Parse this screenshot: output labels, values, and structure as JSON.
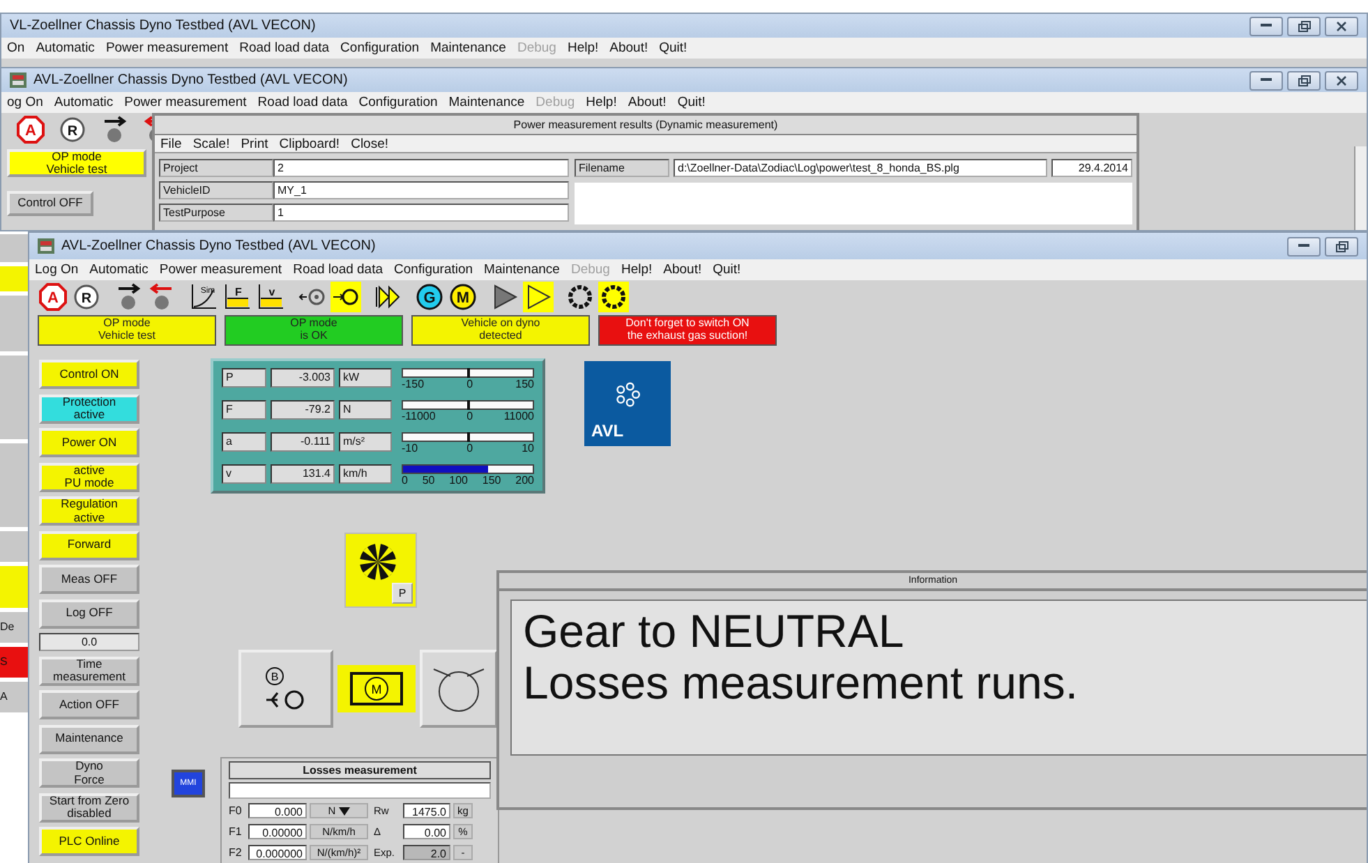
{
  "back_window": {
    "title": "VL-Zoellner Chassis Dyno Testbed  (AVL VECON)",
    "menu": [
      {
        "label": "On",
        "disabled": false
      },
      {
        "label": "Automatic",
        "disabled": false
      },
      {
        "label": "Power measurement",
        "disabled": false
      },
      {
        "label": "Road load data",
        "disabled": false
      },
      {
        "label": "Configuration",
        "disabled": false
      },
      {
        "label": "Maintenance",
        "disabled": false
      },
      {
        "label": "Debug",
        "disabled": true
      },
      {
        "label": "Help!",
        "disabled": false
      },
      {
        "label": "About!",
        "disabled": false
      },
      {
        "label": "Quit!",
        "disabled": false
      }
    ]
  },
  "middle_window": {
    "title": "AVL-Zoellner Chassis Dyno Testbed  (AVL VECON)",
    "menu": [
      {
        "label": "og On",
        "disabled": false
      },
      {
        "label": "Automatic",
        "disabled": false
      },
      {
        "label": "Power measurement",
        "disabled": false
      },
      {
        "label": "Road load data",
        "disabled": false
      },
      {
        "label": "Configuration",
        "disabled": false
      },
      {
        "label": "Maintenance",
        "disabled": false
      },
      {
        "label": "Debug",
        "disabled": true
      },
      {
        "label": "Help!",
        "disabled": false
      },
      {
        "label": "About!",
        "disabled": false
      },
      {
        "label": "Quit!",
        "disabled": false
      }
    ],
    "toolbar": [
      {
        "kind": "stop",
        "label": "A",
        "selected": false
      },
      {
        "kind": "circle",
        "label": "R",
        "selected": false
      },
      {
        "kind": "ball-right",
        "selected": false
      },
      {
        "kind": "ball-left",
        "selected": false
      }
    ],
    "side_buttons": [
      {
        "label": "OP mode\nVehicle test",
        "color": "#ffff00"
      },
      {
        "label": "Control OFF",
        "color": "#c8c8c8"
      }
    ],
    "covered_side_labels": [
      "De",
      "S",
      "A"
    ],
    "results_dialog": {
      "title": "Power measurement results (Dynamic measurement)",
      "menu": [
        "File",
        "Scale!",
        "Print",
        "Clipboard!",
        "Close!"
      ],
      "fields": [
        {
          "label": "Project",
          "value": "2"
        },
        {
          "label": "VehicleID",
          "value": "MY_1"
        },
        {
          "label": "TestPurpose",
          "value": "1"
        }
      ],
      "filename": {
        "label": "Filename",
        "value": "d:\\Zoellner-Data\\Zodiac\\Log\\power\\test_8_honda_BS.plg",
        "date": "29.4.2014"
      }
    }
  },
  "main_window": {
    "title": "AVL-Zoellner Chassis Dyno Testbed  (AVL VECON)",
    "menu": [
      {
        "label": "Log On",
        "disabled": false
      },
      {
        "label": "Automatic",
        "disabled": false
      },
      {
        "label": "Power measurement",
        "disabled": false
      },
      {
        "label": "Road load data",
        "disabled": false
      },
      {
        "label": "Configuration",
        "disabled": false
      },
      {
        "label": "Maintenance",
        "disabled": false
      },
      {
        "label": "Debug",
        "disabled": true
      },
      {
        "label": "Help!",
        "disabled": false
      },
      {
        "label": "About!",
        "disabled": false
      },
      {
        "label": "Quit!",
        "disabled": false
      }
    ],
    "toolbar": [
      {
        "items": [
          {
            "kind": "stop",
            "label": "A",
            "selected": false
          },
          {
            "kind": "circle",
            "label": "R",
            "selected": false
          }
        ]
      },
      {
        "items": [
          {
            "kind": "ball-right",
            "selected": false
          },
          {
            "kind": "ball-left",
            "selected": false
          }
        ]
      },
      {
        "items": [
          {
            "kind": "curve",
            "label": "Sim",
            "selected": false
          },
          {
            "kind": "graph",
            "label": "F",
            "selected": false
          },
          {
            "kind": "graph",
            "label": "v",
            "selected": false
          }
        ]
      },
      {
        "items": [
          {
            "kind": "wheel-in",
            "selected": false
          },
          {
            "kind": "wheel-out",
            "selected": true
          }
        ]
      },
      {
        "items": [
          {
            "kind": "double-play",
            "selected": false
          }
        ]
      },
      {
        "items": [
          {
            "kind": "badge",
            "label": "G",
            "color": "#22ccee",
            "selected": false
          },
          {
            "kind": "badge",
            "label": "M",
            "color": "#ffee00",
            "selected": false
          }
        ]
      },
      {
        "items": [
          {
            "kind": "play",
            "selected": false
          },
          {
            "kind": "play",
            "selected": true
          }
        ]
      },
      {
        "items": [
          {
            "kind": "ring",
            "selected": false
          },
          {
            "kind": "ring",
            "selected": true
          }
        ]
      }
    ],
    "banners": [
      {
        "text": "OP mode\nVehicle test",
        "color": "#f4f400"
      },
      {
        "text": "OP mode\nis OK",
        "color": "#22cc22"
      },
      {
        "text": "Vehicle on dyno\ndetected",
        "color": "#f4f400"
      },
      {
        "text": "Don't forget to switch ON\nthe exhaust gas suction!",
        "color": "#e81010"
      }
    ],
    "side_buttons": [
      {
        "kind": "button",
        "label": "Control ON",
        "color": "#f4f400"
      },
      {
        "kind": "button",
        "label": "Protection\nactive",
        "color": "#33dddd"
      },
      {
        "kind": "button",
        "label": "Power ON",
        "color": "#f4f400"
      },
      {
        "kind": "button",
        "label": "active\nPU mode",
        "color": "#f4f400"
      },
      {
        "kind": "button",
        "label": "Regulation\nactive",
        "color": "#f4f400"
      },
      {
        "kind": "button",
        "label": "Forward",
        "color": "#f4f400"
      },
      {
        "kind": "button",
        "label": "Meas OFF",
        "color": "#c4c4c4"
      },
      {
        "kind": "button",
        "label": "Log OFF",
        "color": "#c4c4c4"
      },
      {
        "kind": "readout",
        "label": "0.0"
      },
      {
        "kind": "button",
        "label": "Time\nmeasurement",
        "color": "#c4c4c4"
      },
      {
        "kind": "button",
        "label": "Action OFF",
        "color": "#c4c4c4"
      },
      {
        "kind": "button",
        "label": "Maintenance",
        "color": "#c4c4c4"
      },
      {
        "kind": "button",
        "label": "Dyno\nForce",
        "color": "#c4c4c4"
      },
      {
        "kind": "button",
        "label": "Start from Zero\ndisabled",
        "color": "#c4c4c4"
      },
      {
        "kind": "button",
        "label": "PLC Online",
        "color": "#f4f400"
      }
    ],
    "gauges": [
      {
        "symbol": "P",
        "value": "-3.003",
        "unit": "kW",
        "kind": "marker",
        "level": 0.49,
        "ticks": [
          "-150",
          "0",
          "150"
        ]
      },
      {
        "symbol": "F",
        "value": "-79.2",
        "unit": "N",
        "kind": "marker",
        "level": 0.496,
        "ticks": [
          "-11000",
          "0",
          "11000"
        ]
      },
      {
        "symbol": "a",
        "value": "-0.111",
        "unit": "m/s²",
        "kind": "marker",
        "level": 0.494,
        "ticks": [
          "-10",
          "0",
          "10"
        ]
      },
      {
        "symbol": "v",
        "value": "131.4",
        "unit": "km/h",
        "kind": "fill",
        "level": 0.657,
        "ticks": [
          "0",
          "50",
          "100",
          "150",
          "200"
        ]
      }
    ],
    "logo": "AVL",
    "fan": {
      "button": "P"
    },
    "drivetrain": {
      "brake": "B",
      "motor": "M"
    },
    "mmi": "MMI",
    "losses": {
      "title": "Losses measurement",
      "rows": [
        {
          "label": "F0",
          "value": "0.000",
          "unit": "N",
          "dropdown": true,
          "label2": "Rw",
          "value2": "1475.0",
          "unit2": "kg",
          "disabled2": false
        },
        {
          "label": "F1",
          "value": "0.00000",
          "unit": "N/km/h",
          "dropdown": false,
          "label2": "Δ",
          "value2": "0.00",
          "unit2": "%",
          "disabled2": false
        },
        {
          "label": "F2",
          "value": "0.000000",
          "unit": "N/(km/h)²",
          "dropdown": false,
          "label2": "Exp.",
          "value2": "2.0",
          "unit2": "-",
          "disabled2": true
        }
      ]
    },
    "info": {
      "title": "Information",
      "lines": [
        "Gear to NEUTRAL",
        "Losses measurement runs."
      ]
    }
  }
}
